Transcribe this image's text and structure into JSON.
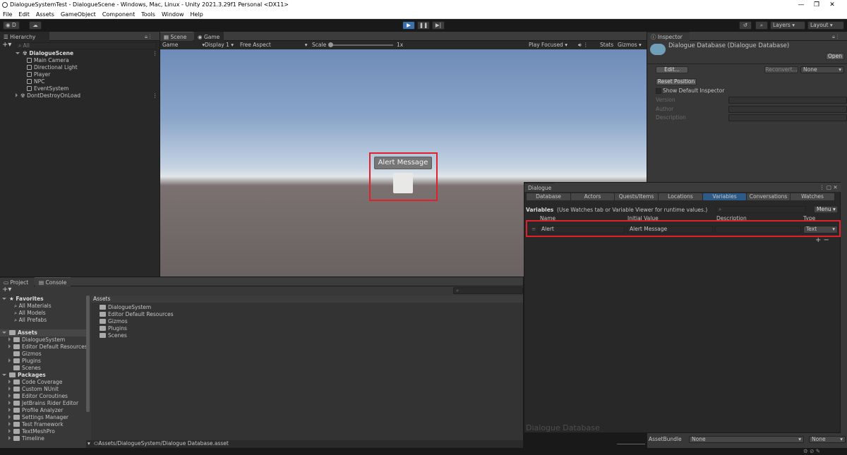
{
  "window": {
    "title": "DialogueSystemTest - DialogueScene - Windows, Mac, Linux - Unity 2021.3.29f1 Personal <DX11>",
    "min": "—",
    "max": "❐",
    "close": "✕"
  },
  "menu": [
    "File",
    "Edit",
    "Assets",
    "GameObject",
    "Component",
    "Tools",
    "Window",
    "Help"
  ],
  "toolbar": {
    "account": "D",
    "layers": "Layers",
    "layout": "Layout"
  },
  "hierarchy": {
    "tab": "Hierarchy",
    "search_placeholder": "All",
    "scene": "DialogueScene",
    "items": [
      "Main Camera",
      "Directional Light",
      "Player",
      "NPC",
      "EventSystem"
    ],
    "ddol": "DontDestroyOnLoad"
  },
  "views": {
    "scene_tab": "Scene",
    "game_tab": "Game",
    "game_label": "Game",
    "display": "Display 1",
    "aspect": "Free Aspect",
    "scale_label": "Scale",
    "scale_value": "1x",
    "play_focused": "Play Focused",
    "stats": "Stats",
    "gizmos": "Gizmos",
    "alert_button": "Alert Message"
  },
  "inspector": {
    "tab": "Inspector",
    "title": "Dialogue Database (Dialogue Database)",
    "open": "Open",
    "edit": "Edit...",
    "reconvert": "Reconvert...",
    "none": "None",
    "reset_position": "Reset Position",
    "show_default": "Show Default Inspector",
    "fields": [
      "Version",
      "Author",
      "Description"
    ],
    "assetbundle_label": "AssetBundle",
    "assetbundle_value": "None",
    "assetbundle_variant": "None"
  },
  "dialogue": {
    "title": "Dialogue",
    "tabs": [
      "Database",
      "Actors",
      "Quests/Items",
      "Locations",
      "Variables",
      "Conversations",
      "Watches"
    ],
    "selected_tab": "Variables",
    "section": "Variables",
    "hint": "(Use Watches tab or Variable Viewer for runtime values.)",
    "menu": "Menu",
    "columns": [
      "Name",
      "Initial Value",
      "Description",
      "Type"
    ],
    "row": {
      "name": "Alert",
      "value": "Alert Message",
      "description": "",
      "type": "Text"
    },
    "footer": "Dialogue Database"
  },
  "project": {
    "tab": "Project",
    "console_tab": "Console",
    "favorites": "Favorites",
    "fav_items": [
      "All Materials",
      "All Models",
      "All Prefabs"
    ],
    "assets": "Assets",
    "asset_items": [
      "DialogueSystem",
      "Editor Default Resources",
      "Gizmos",
      "Plugins",
      "Scenes"
    ],
    "packages": "Packages",
    "package_items": [
      "Code Coverage",
      "Custom NUnit",
      "Editor Coroutines",
      "JetBrains Rider Editor",
      "Profile Analyzer",
      "Settings Manager",
      "Test Framework",
      "TextMeshPro",
      "Timeline"
    ],
    "content_header": "Assets",
    "content_items": [
      "DialogueSystem",
      "Editor Default Resources",
      "Gizmos",
      "Plugins",
      "Scenes"
    ],
    "path": "Assets/DialogueSystem/Dialogue Database.asset"
  }
}
